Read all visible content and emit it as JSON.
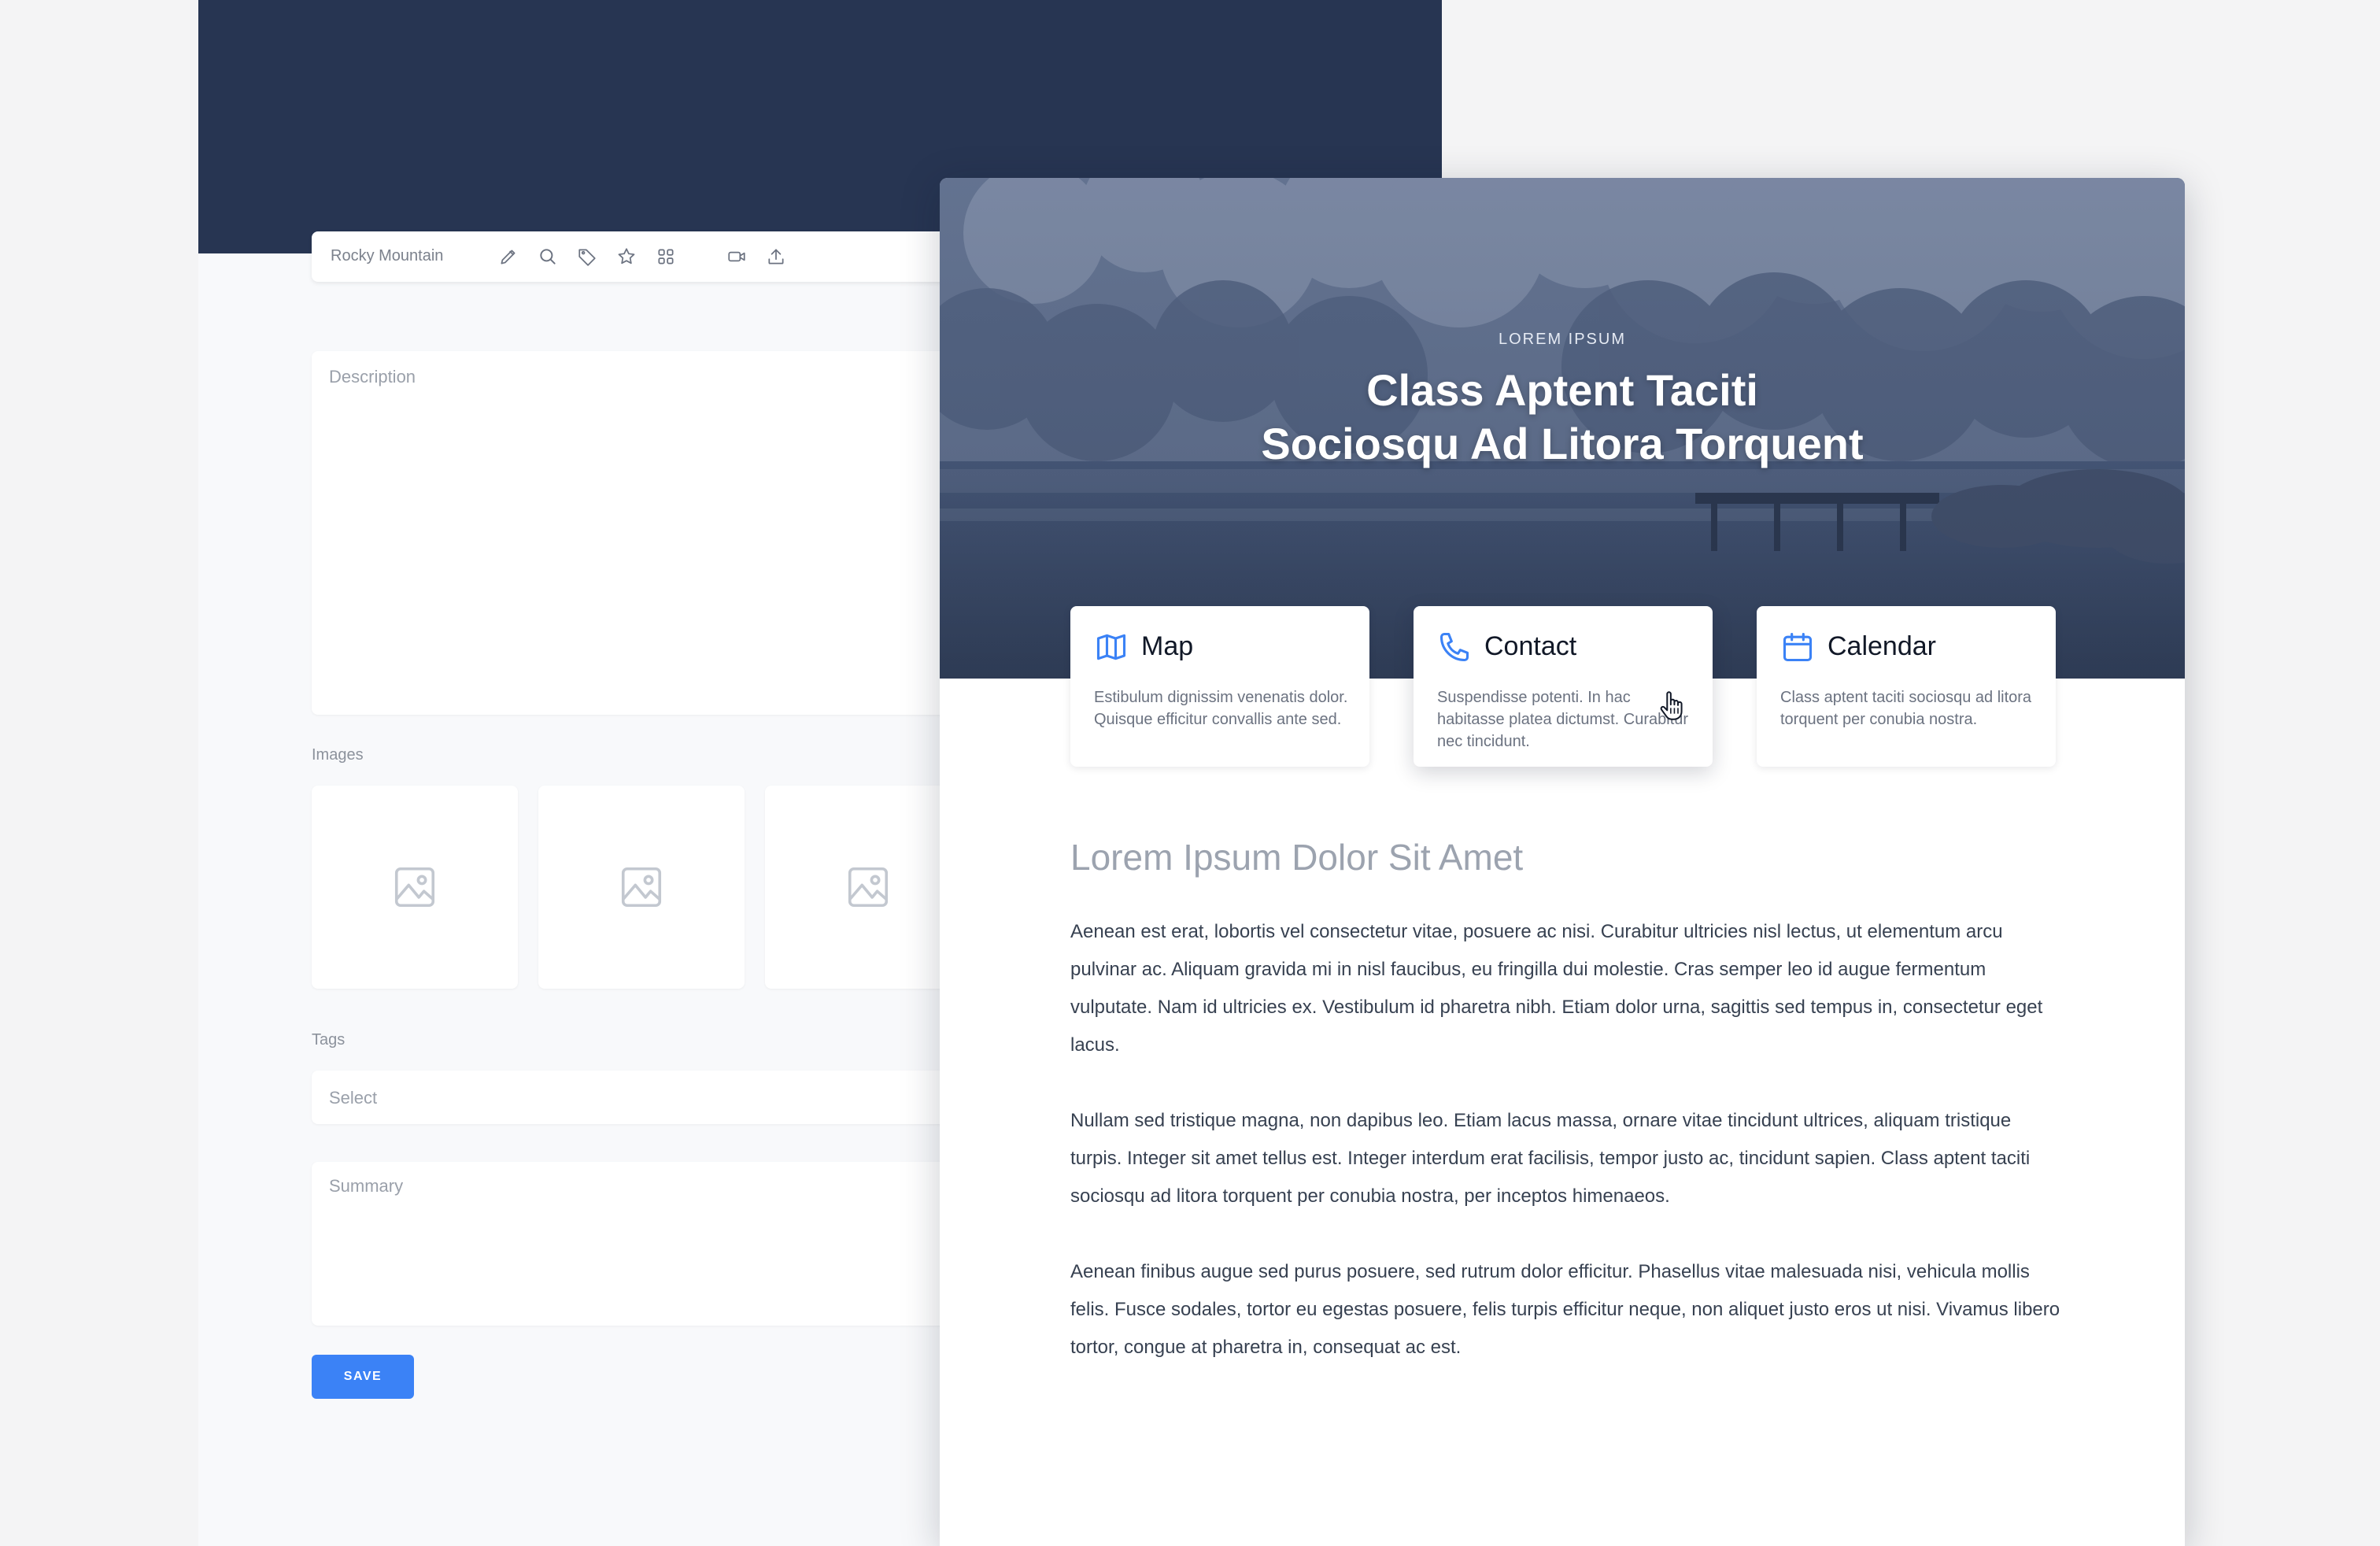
{
  "editor": {
    "toolbar": {
      "title": "Rocky Mountain",
      "icons": [
        "pencil-icon",
        "search-icon",
        "tag-icon",
        "star-icon",
        "grid-icon",
        "video-icon",
        "upload-icon"
      ]
    },
    "description_placeholder": "Description",
    "images_label": "Images",
    "tags_label": "Tags",
    "tags_placeholder": "Select",
    "summary_placeholder": "Summary",
    "save_label": "SAVE",
    "colors": {
      "header": "#273552",
      "accent": "#3b82f6"
    }
  },
  "preview": {
    "eyebrow": "LOREM IPSUM",
    "title_line1": "Class Aptent Taciti",
    "title_line2": "Sociosqu Ad Litora Torquent",
    "cards": [
      {
        "icon": "map-icon",
        "title": "Map",
        "desc": "Estibulum dignissim venenatis dolor. Quisque efficitur convallis ante sed."
      },
      {
        "icon": "phone-icon",
        "title": "Contact",
        "desc": "Suspendisse potenti. In hac habitasse platea dictumst. Curabitur nec tincidunt."
      },
      {
        "icon": "calendar-icon",
        "title": "Calendar",
        "desc": "Class aptent taciti sociosqu ad litora torquent per conubia nostra."
      }
    ],
    "article_title": "Lorem Ipsum Dolor Sit Amet",
    "paragraphs": [
      "Aenean est erat, lobortis vel consectetur vitae, posuere ac nisi. Curabitur ultricies nisl lectus, ut elementum arcu pulvinar ac. Aliquam gravida mi in nisl faucibus, eu fringilla dui molestie. Cras semper leo id augue fermentum vulputate. Nam id ultricies ex. Vestibulum id pharetra nibh. Etiam dolor urna, sagittis sed tempus in, consectetur eget lacus.",
      "Nullam sed tristique magna, non dapibus leo. Etiam lacus massa, ornare vitae tincidunt ultrices, aliquam tristique turpis. Integer sit amet tellus est. Integer interdum erat facilisis, tempor justo ac, tincidunt sapien. Class aptent taciti sociosqu ad litora torquent per conubia nostra, per inceptos himenaeos.",
      "Aenean finibus augue sed purus posuere, sed rutrum dolor efficitur. Phasellus vitae malesuada nisi, vehicula mollis felis. Fusce sodales, tortor eu egestas posuere, felis turpis efficitur neque, non aliquet justo eros ut nisi. Vivamus libero tortor, congue at pharetra in, consequat ac est."
    ]
  }
}
